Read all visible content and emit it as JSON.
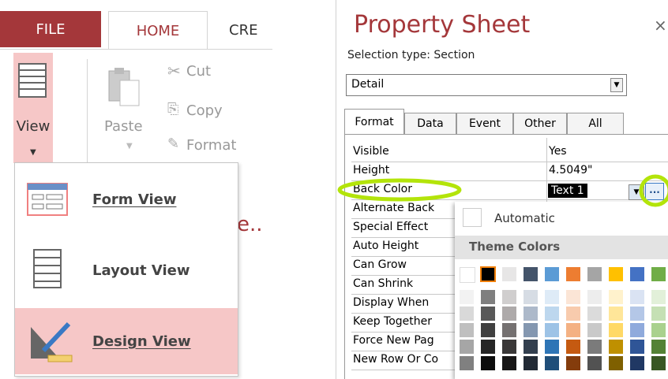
{
  "ribbon": {
    "file_tab": "FILE",
    "home_tab": "HOME",
    "create_tab_partial": "CRE",
    "view_label": "View",
    "paste_label": "Paste",
    "cut_label": "Cut",
    "copy_label": "Copy",
    "format_label": "Format",
    "hidden_fragment": "e.."
  },
  "view_menu": {
    "items": [
      {
        "label": "Form View",
        "icon": "form-view-icon",
        "selected": false
      },
      {
        "label": "Layout View",
        "icon": "layout-view-icon",
        "selected": false
      },
      {
        "label": "Design View",
        "icon": "design-view-icon",
        "selected": true
      }
    ]
  },
  "property_sheet": {
    "title": "Property Sheet",
    "selection_type": "Selection type:  Section",
    "close_label": "×",
    "selected_object": "Detail",
    "tabs": [
      "Format",
      "Data",
      "Event",
      "Other",
      "All"
    ],
    "active_tab": "Format",
    "properties": [
      {
        "name": "Visible",
        "value": "Yes"
      },
      {
        "name": "Height",
        "value": "4.5049\""
      },
      {
        "name": "Back Color",
        "value": "Text 1"
      },
      {
        "name": "Alternate Back",
        "value": ""
      },
      {
        "name": "Special Effect",
        "value": ""
      },
      {
        "name": "Auto Height",
        "value": ""
      },
      {
        "name": "Can Grow",
        "value": ""
      },
      {
        "name": "Can Shrink",
        "value": ""
      },
      {
        "name": "Display When",
        "value": ""
      },
      {
        "name": "Keep Together",
        "value": ""
      },
      {
        "name": "Force New Pag",
        "value": ""
      },
      {
        "name": "New Row Or Co",
        "value": ""
      }
    ],
    "builder_button": "..."
  },
  "color_picker": {
    "automatic_label": "Automatic",
    "theme_colors_label": "Theme Colors",
    "theme_row": [
      "#ffffff",
      "#000000",
      "#e7e6e6",
      "#44546a",
      "#5b9bd5",
      "#ed7d31",
      "#a5a5a5",
      "#ffc000",
      "#4472c4",
      "#70ad47"
    ],
    "selected_swatch": 1,
    "shades": [
      [
        "#f2f2f2",
        "#d9d9d9",
        "#bfbfbf",
        "#a6a6a6",
        "#808080"
      ],
      [
        "#7f7f7f",
        "#595959",
        "#404040",
        "#262626",
        "#0d0d0d"
      ],
      [
        "#d0cece",
        "#aeaaaa",
        "#757171",
        "#3a3838",
        "#171616"
      ],
      [
        "#d6dce4",
        "#adb9ca",
        "#8497b0",
        "#333f4f",
        "#222a35"
      ],
      [
        "#deebf7",
        "#bdd7ee",
        "#9dc3e6",
        "#2e75b6",
        "#1f4e79"
      ],
      [
        "#fbe5d6",
        "#f8cbad",
        "#f4b183",
        "#c55a11",
        "#843c0c"
      ],
      [
        "#ededed",
        "#dbdbdb",
        "#c9c9c9",
        "#7b7b7b",
        "#525252"
      ],
      [
        "#fff2cc",
        "#ffe699",
        "#ffd966",
        "#bf9000",
        "#7f6000"
      ],
      [
        "#dae3f3",
        "#b4c7e7",
        "#8faadc",
        "#2f5597",
        "#203864"
      ],
      [
        "#e2f0d9",
        "#c5e0b4",
        "#a9d18e",
        "#548235",
        "#385723"
      ]
    ]
  },
  "annotations": {
    "highlight_color": "#b3e40a"
  },
  "colors": {
    "accent": "#a4373a",
    "view_highlight": "#f6c7c7"
  }
}
